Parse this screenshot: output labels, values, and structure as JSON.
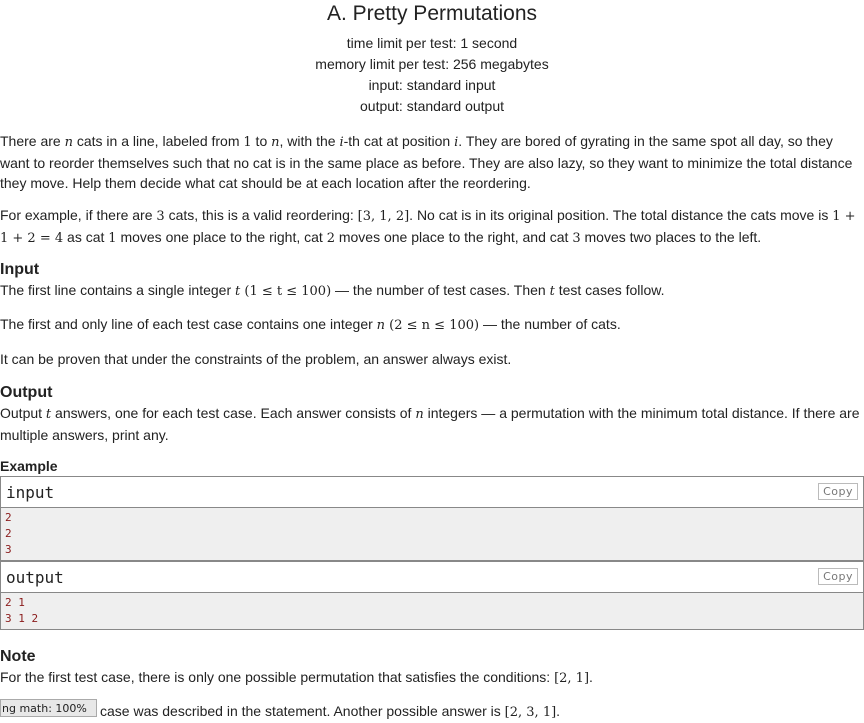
{
  "header": {
    "title": "A. Pretty Permutations",
    "time_limit": "time limit per test: 1 second",
    "memory_limit": "memory limit per test: 256 megabytes",
    "input": "input: standard input",
    "output": "output: standard output"
  },
  "statement": {
    "p1_a": "There are ",
    "p1_n": "n",
    "p1_b": " cats in a line, labeled from ",
    "p1_one": "1",
    "p1_c": " to ",
    "p1_n2": "n",
    "p1_d": ", with the ",
    "p1_i": "i",
    "p1_e": "-th cat at position ",
    "p1_i2": "i",
    "p1_f": ". They are bored of gyrating in the same spot all day, so they want to reorder themselves such that no cat is in the same place as before. They are also lazy, so they want to minimize the total distance they move. Help them decide what cat should be at each location after the reordering.",
    "p2_a": "For example, if there are ",
    "p2_three": "3",
    "p2_b": " cats, this is a valid reordering: ",
    "p2_perm": "[3, 1, 2]",
    "p2_c": ". No cat is in its original position. The total distance the cats move is ",
    "p2_sum": "1 + 1 + 2 = 4",
    "p2_d": " as cat ",
    "p2_c1": "1",
    "p2_e": " moves one place to the right, cat ",
    "p2_c2": "2",
    "p2_f": " moves one place to the right, and cat ",
    "p2_c3": "3",
    "p2_g": " moves two places to the left."
  },
  "input_section": {
    "title": "Input",
    "p1_a": "The first line contains a single integer ",
    "p1_t": "t",
    "p1_range": " (1 ≤ t ≤ 100)",
    "p1_b": " — the number of test cases. Then ",
    "p1_t2": "t",
    "p1_c": " test cases follow.",
    "p2_a": "The first and only line of each test case contains one integer ",
    "p2_n": "n",
    "p2_range": " (2 ≤ n ≤ 100)",
    "p2_b": " — the number of cats.",
    "p3": "It can be proven that under the constraints of the problem, an answer always exist."
  },
  "output_section": {
    "title": "Output",
    "p1_a": "Output ",
    "p1_t": "t",
    "p1_b": " answers, one for each test case. Each answer consists of ",
    "p1_n": "n",
    "p1_c": " integers — a permutation with the minimum total distance. If there are multiple answers, print any."
  },
  "example": {
    "title": "Example",
    "input_label": "input",
    "output_label": "output",
    "copy_label": "Copy",
    "input_lines": [
      "2",
      "2",
      "3"
    ],
    "output_lines": [
      "2 1",
      "3 1 2"
    ]
  },
  "note": {
    "title": "Note",
    "p1_a": "For the first test case, there is only one possible permutation that satisfies the conditions: ",
    "p1_perm": "[2, 1]",
    "p1_b": ".",
    "p2_a": " case was described in the statement. Another possible answer is ",
    "p2_perm": "[2, 3, 1]",
    "p2_b": "."
  },
  "math_badge": "ng math: 100%",
  "colors": {
    "sample_text": "#8a1b1b",
    "sample_bg": "#efefef",
    "border": "#888888"
  }
}
